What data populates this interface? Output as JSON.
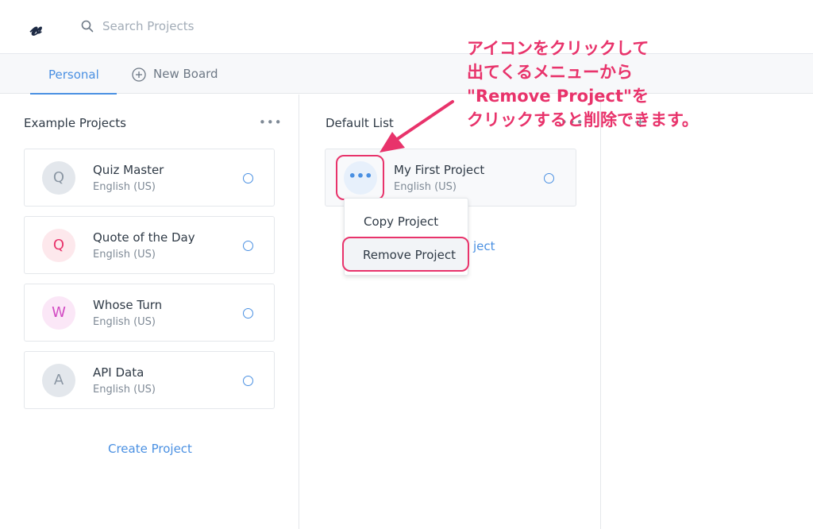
{
  "header": {
    "logo": "𝓿",
    "search_placeholder": "Search Projects"
  },
  "tabs": [
    {
      "label": "Personal",
      "active": true
    },
    {
      "label": "New Board",
      "icon": "plus-circle-icon"
    }
  ],
  "left_column": {
    "title": "Example Projects",
    "menu": "•••",
    "projects": [
      {
        "initial": "Q",
        "name": "Quiz Master",
        "language": "English (US)",
        "avatar_bg": "#e3e7ec",
        "avatar_color": "#8a96a3"
      },
      {
        "initial": "Q",
        "name": "Quote of the Day",
        "language": "English (US)",
        "avatar_bg": "#fde8ec",
        "avatar_color": "#e8336b"
      },
      {
        "initial": "W",
        "name": "Whose Turn",
        "language": "English (US)",
        "avatar_bg": "#fbe7f7",
        "avatar_color": "#d24bc3"
      },
      {
        "initial": "A",
        "name": "API Data",
        "language": "English (US)",
        "avatar_bg": "#e3e7ec",
        "avatar_color": "#8a96a3"
      }
    ],
    "create_label": "Create Project"
  },
  "middle_column": {
    "title": "Default List",
    "menu": "•••",
    "project": {
      "name": "My First Project",
      "language": "English (US)",
      "dots": "•••"
    },
    "context_menu": {
      "copy": "Copy Project",
      "remove": "Remove Project"
    },
    "partial_link": "ject"
  },
  "right_column": {
    "add": "+"
  },
  "annotation": {
    "lines": [
      "アイコンをクリックして",
      "出てくるメニューから",
      "\"Remove Project\"を",
      "クリックすると削除できます。"
    ]
  },
  "colors": {
    "accent": "#4a90e2",
    "annotation": "#e8336b"
  }
}
